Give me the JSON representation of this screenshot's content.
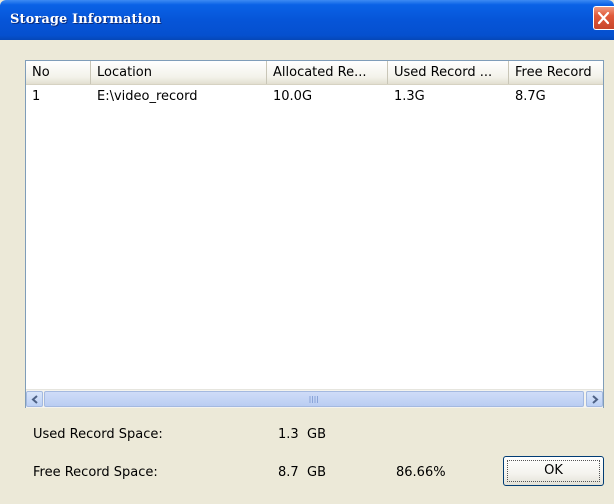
{
  "window": {
    "title": "Storage Information"
  },
  "table": {
    "columns": [
      "No",
      "Location",
      "Allocated Re...",
      "Used Record ...",
      "Free Record"
    ],
    "rows": [
      {
        "no": "1",
        "location": "E:\\video_record",
        "allocated": "10.0G",
        "used": "1.3G",
        "free": "8.7G"
      }
    ]
  },
  "summary": {
    "used_label": "Used Record Space:",
    "used_value": "1.3",
    "used_unit": "GB",
    "free_label": "Free Record Space:",
    "free_value": "8.7",
    "free_unit": "GB",
    "free_percent": "86.66%"
  },
  "buttons": {
    "ok_label": "OK"
  },
  "icons": {
    "close": "close-icon",
    "scroll_left": "chevron-left-icon",
    "scroll_right": "chevron-right-icon"
  },
  "colors": {
    "title_bar": "#0655d8",
    "close_button": "#e0593a",
    "window_bg": "#ece9d8"
  }
}
